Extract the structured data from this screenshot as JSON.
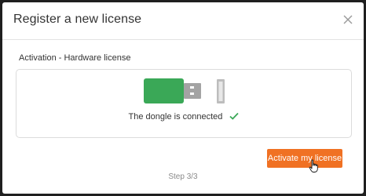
{
  "dialog": {
    "title": "Register a new license",
    "close_icon": "close-icon"
  },
  "activation": {
    "section_label": "Activation - Hardware license",
    "dongle_icon": "usb-dongle-icon",
    "status_text": "The dongle is connected",
    "status_icon": "checkmark-icon"
  },
  "footer": {
    "activate_label": "Activate my license",
    "step_text": "Step 3/3"
  },
  "colors": {
    "accent": "#f07123",
    "dongle_green": "#3aa857",
    "check_green": "#3aa857"
  }
}
